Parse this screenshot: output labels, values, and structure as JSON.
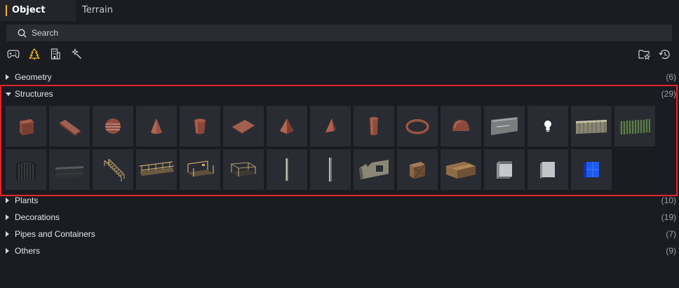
{
  "tabs": [
    {
      "label": "Object",
      "active": true
    },
    {
      "label": "Terrain",
      "active": false
    }
  ],
  "search": {
    "placeholder": "Search"
  },
  "toolbar": {
    "filters": [
      "gamepad-icon",
      "tree-icon",
      "building-icon",
      "magic-wand-icon"
    ],
    "actions": [
      "folder-star-icon",
      "history-icon"
    ],
    "accent": "#f0b429"
  },
  "categories": [
    {
      "name": "Geometry",
      "count": "(6)",
      "expanded": false
    },
    {
      "name": "Structures",
      "count": "(29)",
      "expanded": true
    },
    {
      "name": "Plants",
      "count": "(10)",
      "expanded": false
    },
    {
      "name": "Decorations",
      "count": "(19)",
      "expanded": false
    },
    {
      "name": "Pipes and Containers",
      "count": "(7)",
      "expanded": false
    },
    {
      "name": "Others",
      "count": "(9)",
      "expanded": false
    }
  ],
  "structures_thumbnails": [
    "brick-cube-icon",
    "brick-wedge-icon",
    "brick-sphere-icon",
    "brick-cone-icon",
    "brick-cylinder-icon",
    "brick-plane-icon",
    "brick-pyramid-icon",
    "brick-tetrahedron-icon",
    "brick-tall-cylinder-icon",
    "brick-ring-icon",
    "brick-hemisphere-icon",
    "sign-panel-icon",
    "light-bulb-icon",
    "metal-fence-icon",
    "green-fence-icon",
    "iron-gate-icon",
    "dark-wall-icon",
    "stairs-icon",
    "bridge-railing-icon",
    "platform-railing-icon",
    "platform-frame-icon",
    "thin-pillar-icon",
    "metal-pillar-icon",
    "broken-wall-icon",
    "wooden-crate-icon",
    "wooden-box-icon",
    "grey-cube-icon",
    "grey-box-icon",
    "blue-cube-icon"
  ],
  "colors": {
    "background": "#1b1c21",
    "tile": "#2a2c33",
    "highlight": "#e0262a",
    "accent": "#f0b429"
  }
}
